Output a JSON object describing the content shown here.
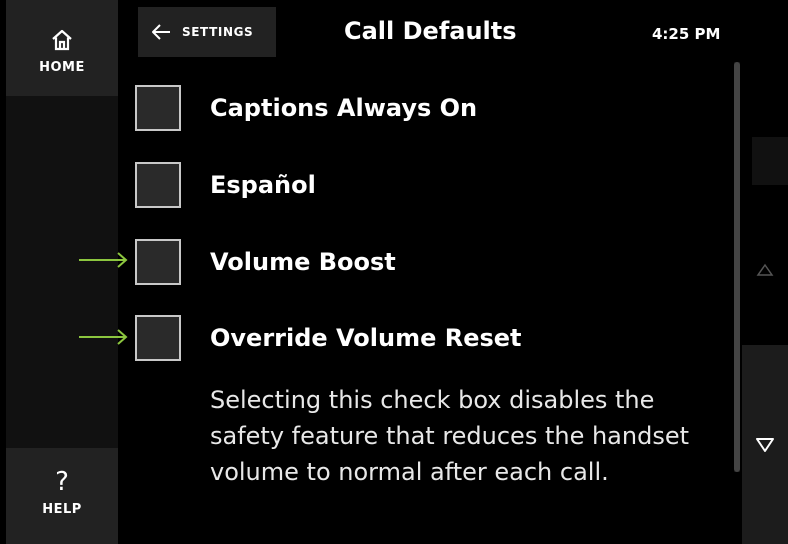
{
  "nav": {
    "home": {
      "label": "HOME",
      "icon": "home-icon"
    },
    "help": {
      "label": "HELP",
      "icon": "question-icon",
      "glyph": "?"
    }
  },
  "header": {
    "back_label": "SETTINGS",
    "back_icon": "arrow-left-icon",
    "title": "Call Defaults",
    "time": "4:25 PM"
  },
  "options": [
    {
      "label": "Captions Always On",
      "checked": false
    },
    {
      "label": "Español",
      "checked": false
    },
    {
      "label": "Volume Boost",
      "checked": false,
      "marked": true
    },
    {
      "label": "Override Volume Reset",
      "checked": false,
      "marked": true
    }
  ],
  "description": "Selecting this check box disables the safety feature that reduces the handset volume to normal after each call.",
  "scroll": {
    "up_icon": "triangle-up-icon",
    "down_icon": "triangle-down-icon"
  },
  "colors": {
    "background": "#000000",
    "panel": "#222222",
    "annotation_arrow": "#8cc63f",
    "checkbox_border": "#c8c8c8"
  }
}
